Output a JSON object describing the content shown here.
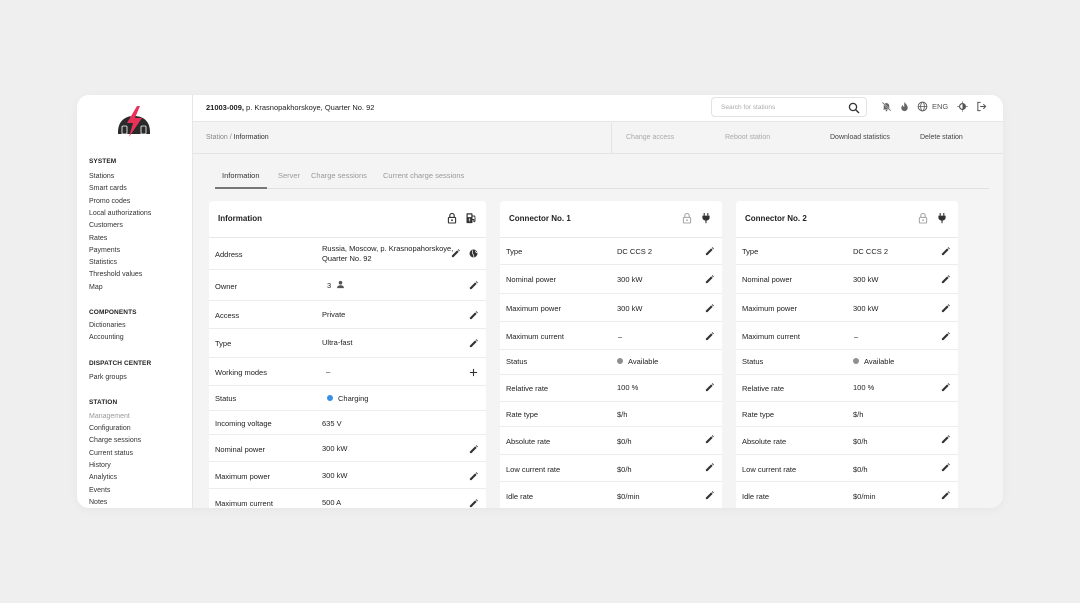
{
  "header": {
    "station_id": "21003-009,",
    "station_address": " p. Krasnopakhorskoye, Quarter No. 92",
    "search_placeholder": "Search for stations",
    "language": "ENG"
  },
  "breadcrumb": {
    "root": "Station",
    "separator": " / ",
    "current": "Information"
  },
  "actions": {
    "change_access": "Change access",
    "reboot": "Reboot station",
    "download": "Download statistics",
    "delete": "Delete station"
  },
  "sidebar": {
    "sections": [
      {
        "title": "SYSTEM",
        "items": [
          "Stations",
          "Smart cards",
          "Promo codes",
          "Local authorizations",
          "Customers",
          "Rates",
          "Payments",
          "Statistics",
          "Threshold values",
          "Map"
        ]
      },
      {
        "title": "COMPONENTS",
        "items": [
          "Dictionaries",
          "Accounting"
        ]
      },
      {
        "title": "DISPATCH CENTER",
        "items": [
          "Park groups"
        ]
      },
      {
        "title": "STATION",
        "items": [
          "Management",
          "Configuration",
          "Charge sessions",
          "Current status",
          "History",
          "Analytics",
          "Events",
          "Notes"
        ]
      }
    ]
  },
  "tabs": [
    "Information",
    "Server",
    "Charge sessions",
    "Current charge sessions"
  ],
  "info_card": {
    "title": "Information",
    "rows": [
      {
        "label": "Address",
        "value": "Russia, Moscow, p. Krasnopahorskoye, Quarter No. 92"
      },
      {
        "label": "Owner",
        "value": "3"
      },
      {
        "label": "Access",
        "value": "Private"
      },
      {
        "label": "Type",
        "value": "Ultra-fast"
      },
      {
        "label": "Working modes",
        "value": "–"
      },
      {
        "label": "Status",
        "value": "Charging"
      },
      {
        "label": "Incoming voltage",
        "value": "635 V"
      },
      {
        "label": "Nominal power",
        "value": "300 kW"
      },
      {
        "label": "Maximum power",
        "value": "300 kW"
      },
      {
        "label": "Maximum current",
        "value": "500 A"
      }
    ]
  },
  "connectors": [
    {
      "title": "Connector No. 1",
      "rows": [
        {
          "label": "Type",
          "value": "DC CCS 2"
        },
        {
          "label": "Nominal power",
          "value": "300 kW"
        },
        {
          "label": "Maximum power",
          "value": "300 kW"
        },
        {
          "label": "Maximum current",
          "value": "–"
        },
        {
          "label": "Status",
          "value": "Available"
        },
        {
          "label": "Relative rate",
          "value": "100 %"
        },
        {
          "label": "Rate type",
          "value": "$/h"
        },
        {
          "label": "Absolute rate",
          "value": "$0/h"
        },
        {
          "label": "Low current rate",
          "value": "$0/h"
        },
        {
          "label": "Idle rate",
          "value": "$0/min"
        }
      ]
    },
    {
      "title": "Connector No. 2",
      "rows": [
        {
          "label": "Type",
          "value": "DC CCS 2"
        },
        {
          "label": "Nominal power",
          "value": "300 kW"
        },
        {
          "label": "Maximum power",
          "value": "300 kW"
        },
        {
          "label": "Maximum current",
          "value": "–"
        },
        {
          "label": "Status",
          "value": "Available"
        },
        {
          "label": "Relative rate",
          "value": "100 %"
        },
        {
          "label": "Rate type",
          "value": "$/h"
        },
        {
          "label": "Absolute rate",
          "value": "$0/h"
        },
        {
          "label": "Low current rate",
          "value": "$0/h"
        },
        {
          "label": "Idle rate",
          "value": "$0/min"
        }
      ]
    }
  ],
  "colors": {
    "brand": "#e8325a",
    "charging": "#3a8ee6",
    "available": "#8f8f8f"
  }
}
